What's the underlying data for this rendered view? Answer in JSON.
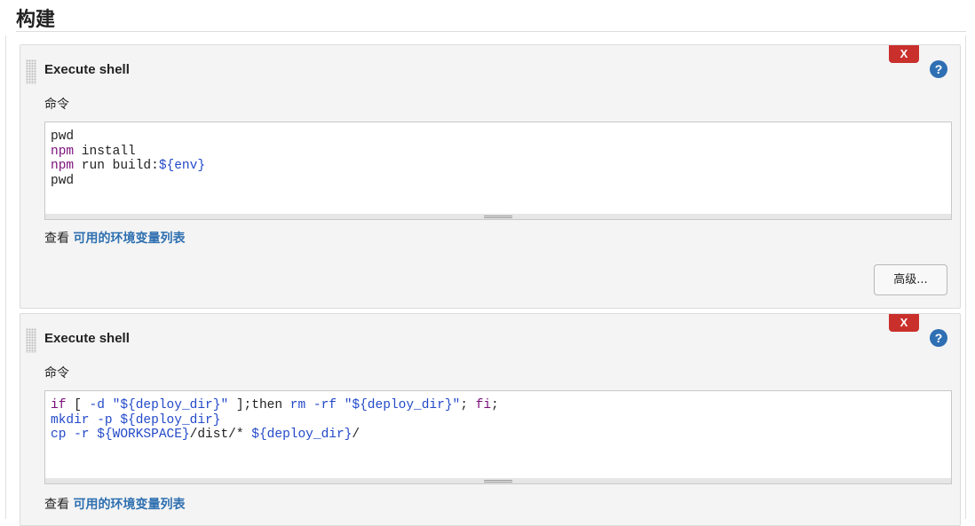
{
  "section": {
    "title": "构建"
  },
  "steps": [
    {
      "title": "Execute shell",
      "delete_label": "X",
      "help_label": "?",
      "field_label": "命令",
      "code_lines": [
        [
          {
            "t": "pwd",
            "c": ""
          }
        ],
        [
          {
            "t": "npm",
            "c": "kw"
          },
          {
            "t": " install",
            "c": ""
          }
        ],
        [
          {
            "t": "npm",
            "c": "kw"
          },
          {
            "t": " run build:",
            "c": ""
          },
          {
            "t": "${env}",
            "c": "var"
          }
        ],
        [
          {
            "t": "pwd",
            "c": ""
          }
        ]
      ],
      "env_prefix": "查看",
      "env_link": "可用的环境变量列表",
      "advanced_label": "高级..."
    },
    {
      "title": "Execute shell",
      "delete_label": "X",
      "help_label": "?",
      "field_label": "命令",
      "code_lines": [
        [
          {
            "t": "if",
            "c": "kw"
          },
          {
            "t": " [ ",
            "c": ""
          },
          {
            "t": "-d",
            "c": "var"
          },
          {
            "t": " ",
            "c": ""
          },
          {
            "t": "\"${deploy_dir}\"",
            "c": "var"
          },
          {
            "t": " ];then ",
            "c": ""
          },
          {
            "t": "rm -rf",
            "c": "var"
          },
          {
            "t": " ",
            "c": ""
          },
          {
            "t": "\"${deploy_dir}\"",
            "c": "var"
          },
          {
            "t": "; ",
            "c": ""
          },
          {
            "t": "fi",
            "c": "kw"
          },
          {
            "t": ";",
            "c": ""
          }
        ],
        [
          {
            "t": "mkdir -p ",
            "c": "var"
          },
          {
            "t": "${deploy_dir}",
            "c": "var"
          }
        ],
        [
          {
            "t": "cp -r ",
            "c": "var"
          },
          {
            "t": "${WORKSPACE}",
            "c": "var"
          },
          {
            "t": "/dist/* ",
            "c": ""
          },
          {
            "t": "${deploy_dir}",
            "c": "var"
          },
          {
            "t": "/",
            "c": ""
          }
        ]
      ],
      "env_prefix": "查看",
      "env_link": "可用的环境变量列表"
    }
  ],
  "colors": {
    "delete": "#c9302c",
    "help": "#2f6fb3",
    "link": "#2e6fb0",
    "keyword": "#7a0f7a",
    "variable": "#2249c9"
  }
}
